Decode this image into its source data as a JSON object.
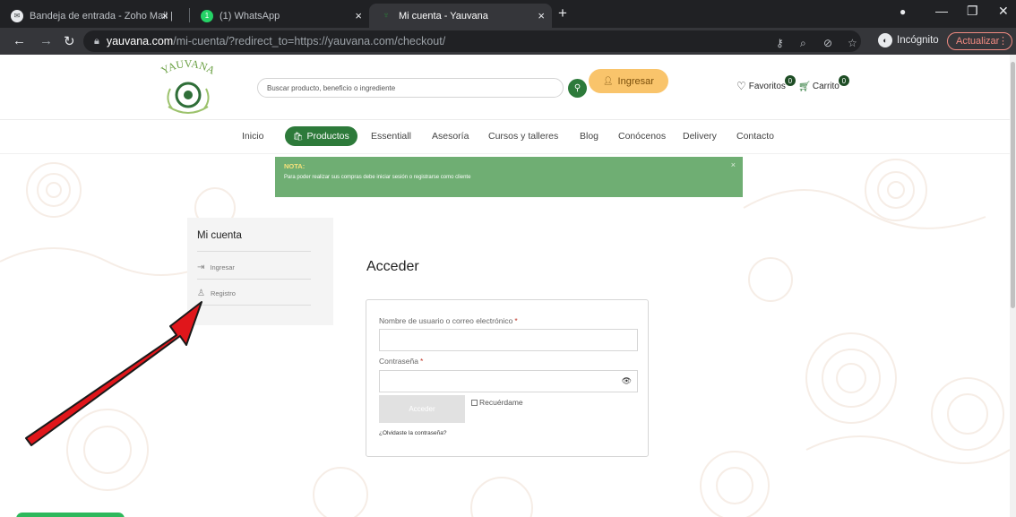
{
  "browser": {
    "tabs": [
      {
        "title": "Bandeja de entrada - Zoho Mail |",
        "icon": "zoho-mail-icon",
        "active": false
      },
      {
        "title": "(1) WhatsApp",
        "icon": "whatsapp-icon",
        "badge": "1",
        "active": false
      },
      {
        "title": "Mi cuenta - Yauvana",
        "icon": "yauvana-icon",
        "active": true
      }
    ],
    "url_host": "yauvana.com",
    "url_path": "/mi-cuenta/?redirect_to=https://yauvana.com/checkout/",
    "incognito_label": "Incógnito",
    "update_label": "Actualizar",
    "colors": {
      "tabbar": "#202124",
      "toolbar": "#35363a",
      "update": "#f28b82"
    }
  },
  "header": {
    "logo_text": "YAUVANA",
    "search_placeholder": "Buscar producto, beneficio o ingrediente",
    "login_label": "Ingresar",
    "favorites_label": "Favoritos",
    "favorites_count": "0",
    "cart_label": "Carrito",
    "cart_count": "0"
  },
  "nav": {
    "items": [
      {
        "label": "Inicio"
      },
      {
        "label": "Productos",
        "active": true
      },
      {
        "label": "Essentiall"
      },
      {
        "label": "Asesoría"
      },
      {
        "label": "Cursos y talleres"
      },
      {
        "label": "Blog"
      },
      {
        "label": "Conócenos"
      },
      {
        "label": "Delivery"
      },
      {
        "label": "Contacto"
      }
    ]
  },
  "notice": {
    "title": "NOTA:",
    "text": "Para poder realizar sus compras debe iniciar sesión o registrarse como cliente",
    "close": "×"
  },
  "account": {
    "title": "Mi cuenta",
    "items": [
      {
        "label": "Ingresar",
        "icon": "login-icon"
      },
      {
        "label": "Registro",
        "icon": "add-user-icon"
      }
    ]
  },
  "login_form": {
    "title": "Acceder",
    "username_label": "Nombre de usuario o correo electrónico",
    "password_label": "Contraseña",
    "required_mark": "*",
    "submit_label": "Acceder",
    "remember_label": "Recuérdame",
    "forgot_label": "¿Olvidaste la contraseña?"
  },
  "colors": {
    "brand_green": "#2d7a3a",
    "login_yellow": "#f9c46b",
    "notice_green": "#6fae73",
    "annotation_arrow": "#e0161b"
  }
}
